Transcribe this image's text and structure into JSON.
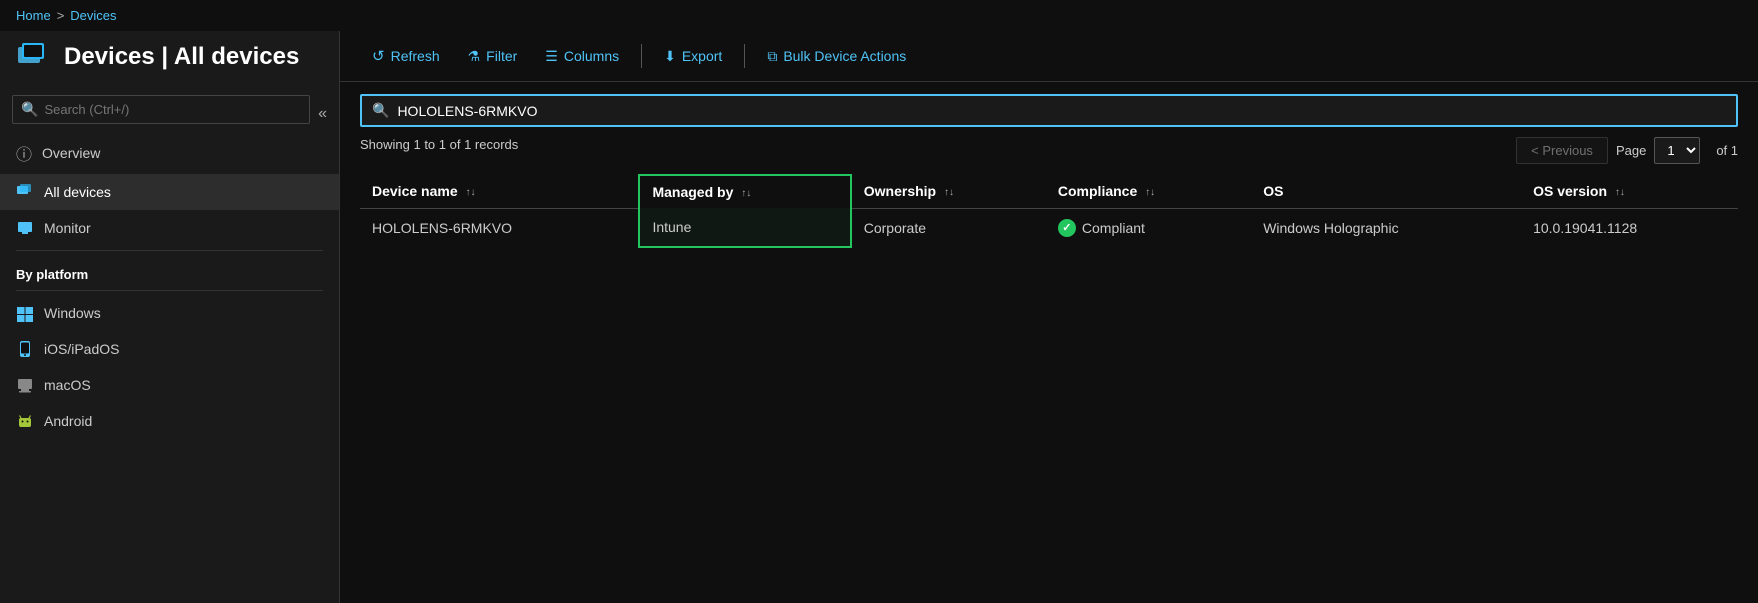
{
  "breadcrumb": {
    "home": "Home",
    "separator": ">",
    "current": "Devices"
  },
  "page": {
    "title": "Devices | All devices"
  },
  "sidebar": {
    "search_placeholder": "Search (Ctrl+/)",
    "nav_items": [
      {
        "id": "overview",
        "label": "Overview",
        "icon": "overview",
        "active": false
      },
      {
        "id": "all-devices",
        "label": "All devices",
        "icon": "alldevices",
        "active": true
      },
      {
        "id": "monitor",
        "label": "Monitor",
        "icon": "monitor",
        "active": false
      }
    ],
    "by_platform_header": "By platform",
    "platform_items": [
      {
        "id": "windows",
        "label": "Windows",
        "icon": "windows"
      },
      {
        "id": "ios",
        "label": "iOS/iPadOS",
        "icon": "ios"
      },
      {
        "id": "macos",
        "label": "macOS",
        "icon": "macos"
      },
      {
        "id": "android",
        "label": "Android",
        "icon": "android"
      }
    ]
  },
  "toolbar": {
    "refresh_label": "Refresh",
    "filter_label": "Filter",
    "columns_label": "Columns",
    "export_label": "Export",
    "bulk_actions_label": "Bulk Device Actions"
  },
  "table": {
    "search_value": "HOLOLENS-6RMKVO",
    "search_placeholder": "Search",
    "record_count": "Showing 1 to 1 of 1 records",
    "pagination": {
      "previous_label": "< Previous",
      "page_label": "Page",
      "page_value": "1",
      "of_label": "of 1"
    },
    "columns": [
      {
        "id": "device-name",
        "label": "Device name"
      },
      {
        "id": "managed-by",
        "label": "Managed by",
        "highlighted": true
      },
      {
        "id": "ownership",
        "label": "Ownership"
      },
      {
        "id": "compliance",
        "label": "Compliance"
      },
      {
        "id": "os",
        "label": "OS"
      },
      {
        "id": "os-version",
        "label": "OS version"
      }
    ],
    "rows": [
      {
        "device_name": "HOLOLENS-6RMKVO",
        "managed_by": "Intune",
        "ownership": "Corporate",
        "compliance_status": "Compliant",
        "os": "Windows Holographic",
        "os_version": "10.0.19041.1128"
      }
    ]
  }
}
